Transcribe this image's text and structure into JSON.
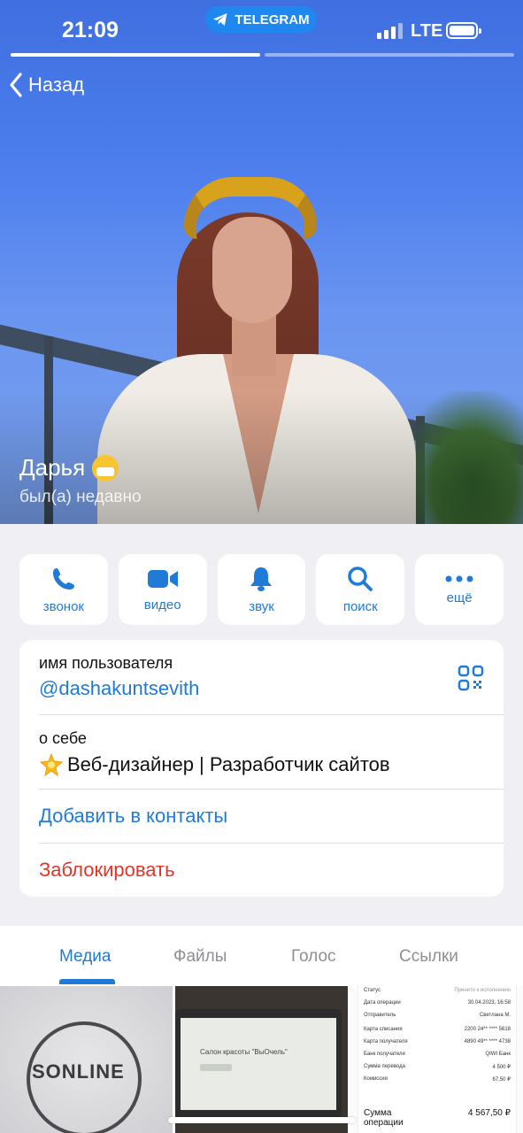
{
  "status_bar": {
    "time": "21:09",
    "app_badge": "TELEGRAM",
    "network": "LTE",
    "battery_icon": "battery-full-icon",
    "signal_icon": "signal-bars-icon"
  },
  "nav": {
    "back_label": "Назад",
    "back_icon": "chevron-left-icon"
  },
  "profile": {
    "name": "Дарья",
    "name_emoji": "face-with-medical-mask-emoji",
    "status": "был(а) недавно"
  },
  "actions": [
    {
      "label": "звонок",
      "icon": "phone-icon"
    },
    {
      "label": "видео",
      "icon": "video-camera-icon"
    },
    {
      "label": "звук",
      "icon": "bell-icon"
    },
    {
      "label": "поиск",
      "icon": "search-icon"
    },
    {
      "label": "ещё",
      "icon": "more-dots-icon"
    }
  ],
  "info": {
    "username_caption": "имя пользователя",
    "username": "@dashakuntsevith",
    "qr_icon": "qr-code-icon",
    "bio_caption": "о себе",
    "bio_emoji": "glowing-star-emoji",
    "bio": "Веб-дизайнер | Разработчик сайтов",
    "add_contact": "Добавить в контакты",
    "block": "Заблокировать"
  },
  "tabs": [
    {
      "label": "Медиа",
      "active": true
    },
    {
      "label": "Файлы",
      "active": false
    },
    {
      "label": "Голос",
      "active": false
    },
    {
      "label": "Ссылки",
      "active": false
    }
  ],
  "media": {
    "thumb1_text": "SONLINE",
    "thumb2_text": "Салон красоты \"ВыОчель\"",
    "receipt": {
      "rows": [
        [
          "Статус",
          "Принято к исполнению"
        ],
        [
          "Дата операции",
          "30.04.2023, 16:58"
        ],
        [
          "Отправитель",
          "Светлана М."
        ],
        [
          "Карта списания",
          "2200 24** **** 5618"
        ],
        [
          "Карта получателя",
          "4890 49** **** 4738"
        ],
        [
          "Банк получателя",
          "QIWI Банк"
        ],
        [
          "Сумма перевода",
          "4 500 ₽"
        ],
        [
          "Комиссия",
          "67,50 ₽"
        ]
      ],
      "total_label": "Сумма операции",
      "total_value": "4 567,50 ₽"
    }
  },
  "colors": {
    "accent": "#1f7bd7",
    "danger": "#e0352b",
    "telegram": "#1e88f0",
    "background": "#efeff4"
  }
}
